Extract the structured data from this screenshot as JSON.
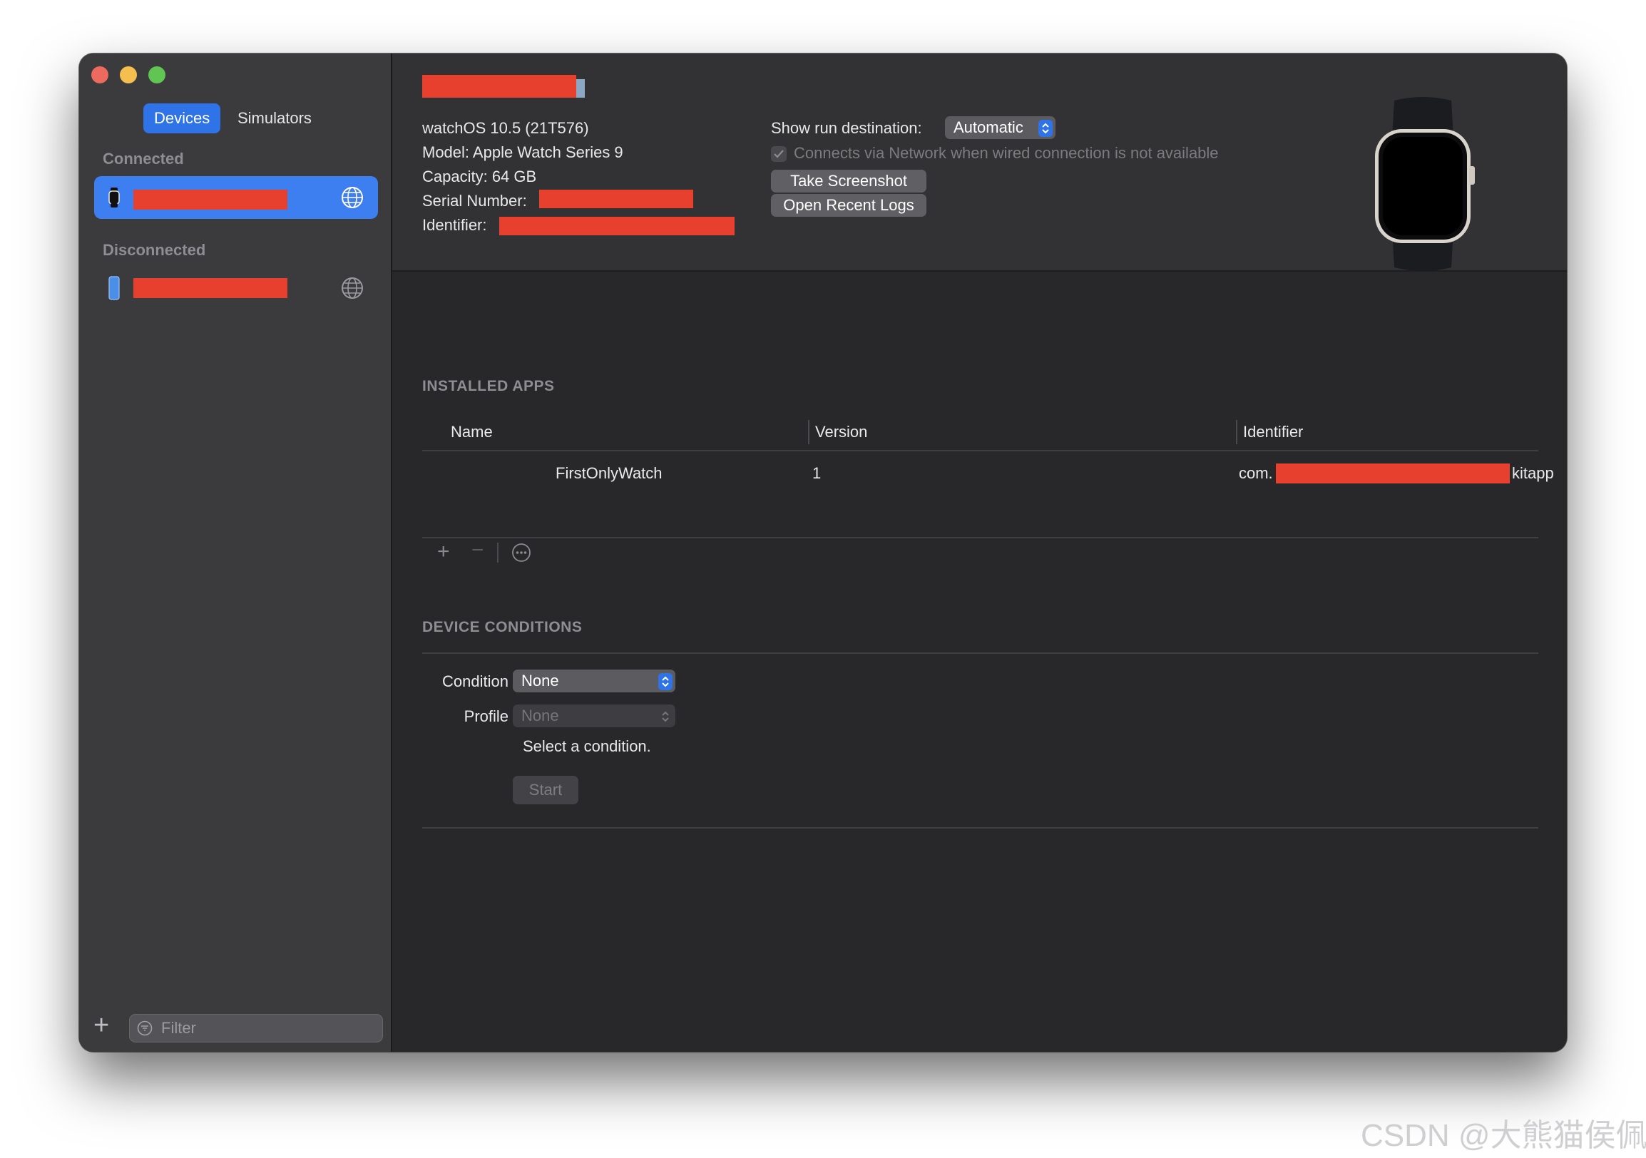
{
  "sidebar": {
    "tabs": [
      {
        "label": "Devices"
      },
      {
        "label": "Simulators"
      }
    ],
    "connected_label": "Connected",
    "disconnected_label": "Disconnected",
    "filter_placeholder": "Filter"
  },
  "device": {
    "os": "watchOS 10.5 (21T576)",
    "model": "Model: Apple Watch Series 9",
    "capacity": "Capacity: 64 GB",
    "serial_label": "Serial Number:",
    "identifier_label": "Identifier:"
  },
  "run_destination": {
    "label": "Show run destination:",
    "value": "Automatic",
    "network_checkbox_label": "Connects via Network when wired connection is not available"
  },
  "buttons": {
    "screenshot": "Take Screenshot",
    "logs": "Open Recent Logs"
  },
  "installed_apps": {
    "title": "INSTALLED APPS",
    "columns": [
      "Name",
      "Version",
      "Identifier"
    ],
    "rows": [
      {
        "name": "FirstOnlyWatch",
        "version": "1",
        "identifier_prefix": "com.",
        "identifier_suffix": "kitapp"
      }
    ]
  },
  "device_conditions": {
    "title": "DEVICE CONDITIONS",
    "condition_label": "Condition",
    "condition_value": "None",
    "profile_label": "Profile",
    "profile_value": "None",
    "hint": "Select a condition.",
    "start_label": "Start"
  },
  "watermark": "CSDN @大熊猫侯佩",
  "colors": {
    "accent": "#2f73e8",
    "selection": "#3d7ef0",
    "redaction": "#e8402f"
  }
}
